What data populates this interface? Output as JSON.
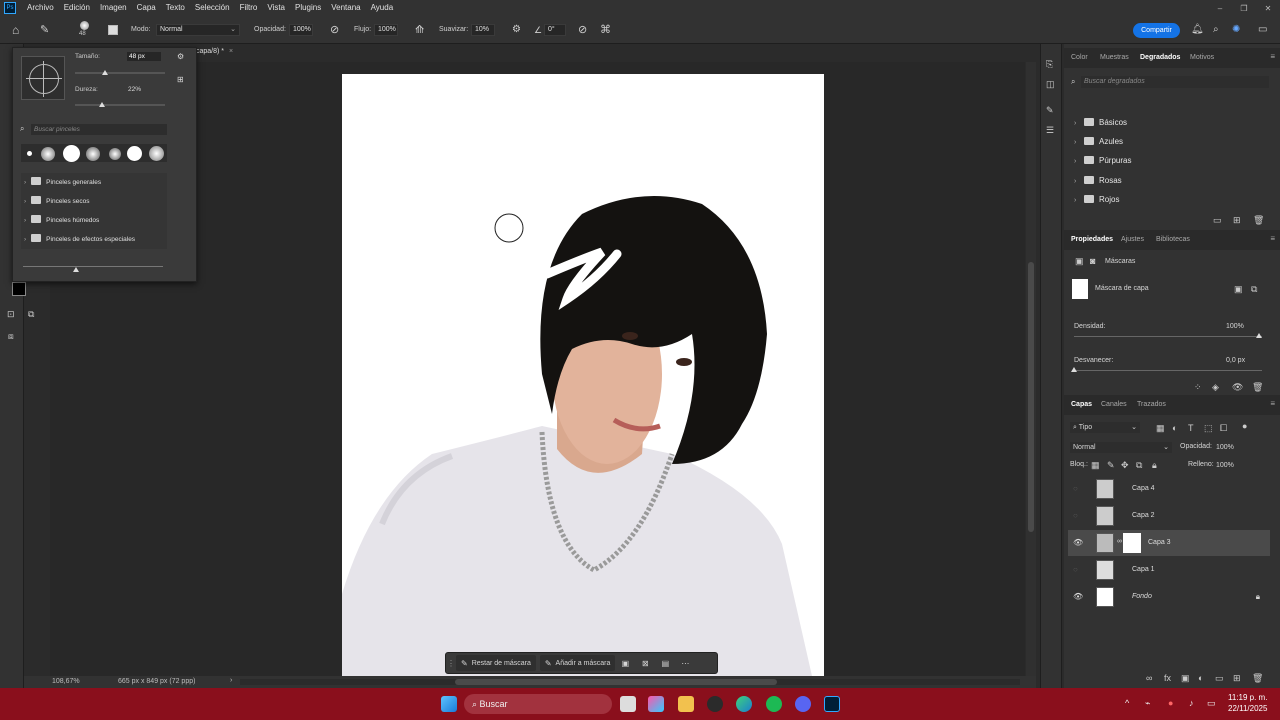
{
  "menu": [
    "Archivo",
    "Edición",
    "Imagen",
    "Capa",
    "Texto",
    "Selección",
    "Filtro",
    "Vista",
    "Plugins",
    "Ventana",
    "Ayuda"
  ],
  "options": {
    "brush_size_badge": "48",
    "mode_label": "Modo:",
    "mode_value": "Normal",
    "opacity_label": "Opacidad:",
    "opacity_value": "100%",
    "flow_label": "Flujo:",
    "flow_value": "100%",
    "smooth_label": "Suavizar:",
    "smooth_value": "10%",
    "angle_value": "0°",
    "share_button": "Compartir"
  },
  "doc_tab": "capa/8) *",
  "brush_panel": {
    "size_label": "Tamaño:",
    "size_value": "48 px",
    "hardness_label": "Dureza:",
    "hardness_value": "22%",
    "size_slider_fraction": 0.33,
    "hardness_slider_fraction": 0.3,
    "search_placeholder": "Buscar pinceles",
    "categories": [
      "Pinceles generales",
      "Pinceles secos",
      "Pinceles húmedos",
      "Pinceles de efectos especiales"
    ]
  },
  "status": {
    "zoom": "108,67%",
    "dimensions": "665 px x 849 px (72 ppp)"
  },
  "context_bar": {
    "subtract": "Restar de máscara",
    "add": "Añadir a máscara"
  },
  "gradients_panel": {
    "tabs": [
      "Color",
      "Muestras",
      "Degradados",
      "Motivos"
    ],
    "active_tab": "Degradados",
    "search_placeholder": "Buscar degradados",
    "groups": [
      "Básicos",
      "Azules",
      "Púrpuras",
      "Rosas",
      "Rojos"
    ]
  },
  "properties_panel": {
    "tabs": [
      "Propiedades",
      "Ajustes",
      "Bibliotecas"
    ],
    "active_tab": "Propiedades",
    "section": "Máscaras",
    "mask_label": "Máscara de capa",
    "density_label": "Densidad:",
    "density_value": "100%",
    "feather_label": "Desvanecer:",
    "feather_value": "0,0 px"
  },
  "layers_panel": {
    "tabs": [
      "Capas",
      "Canales",
      "Trazados"
    ],
    "active_tab": "Capas",
    "filter_label": "Tipo",
    "blend_mode": "Normal",
    "opacity_label": "Opacidad:",
    "opacity_value": "100%",
    "lock_label": "Bloq.:",
    "fill_label": "Relleno:",
    "fill_value": "100%",
    "layers": [
      {
        "name": "Capa 4",
        "visible": false,
        "selected": false
      },
      {
        "name": "Capa 2",
        "visible": false,
        "selected": false
      },
      {
        "name": "Capa 3",
        "visible": true,
        "selected": true
      },
      {
        "name": "Capa 1",
        "visible": false,
        "selected": false
      },
      {
        "name": "Fondo",
        "visible": true,
        "selected": false
      }
    ]
  },
  "taskbar": {
    "search_placeholder": "Buscar",
    "time": "11:19 p. m.",
    "date": "22/11/2025"
  },
  "colors": {
    "accent": "#1473e6",
    "taskbar": "#8a0f1c",
    "panel": "#323232"
  }
}
